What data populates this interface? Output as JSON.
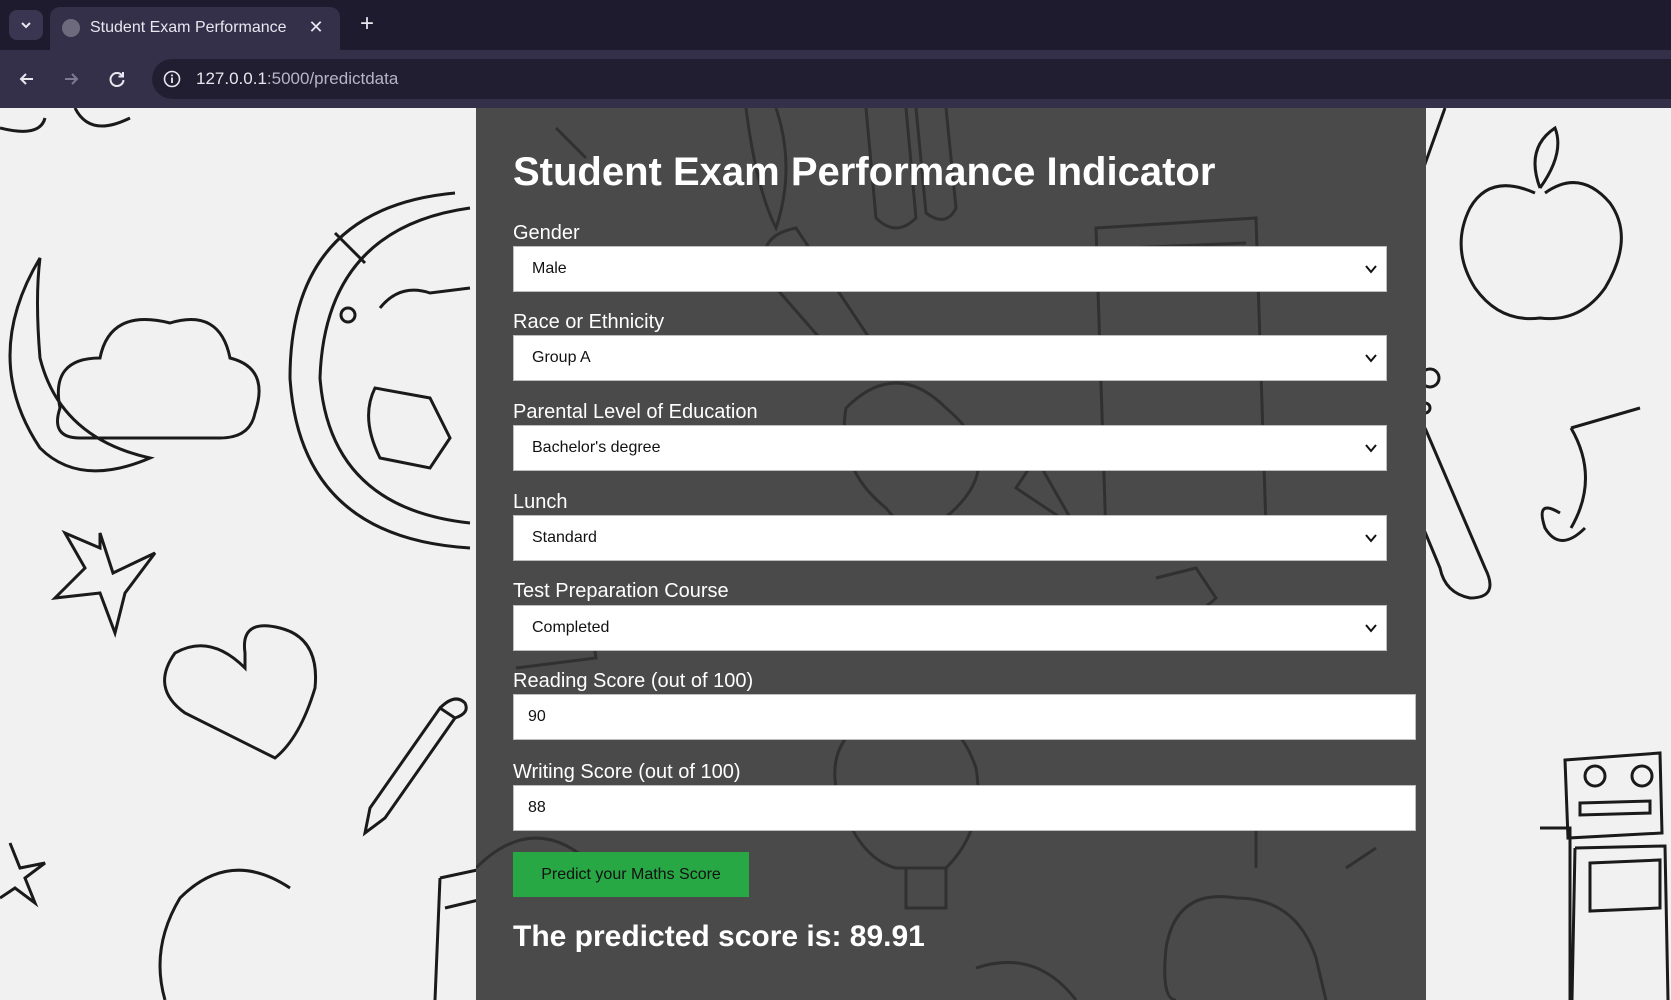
{
  "browser": {
    "tab_title": "Student Exam Performance",
    "url_host": "127.0.0.1",
    "url_rest": ":5000/predictdata"
  },
  "page": {
    "title": "Student Exam Performance Indicator",
    "fields": {
      "gender": {
        "label": "Gender",
        "value": "Male"
      },
      "race": {
        "label": "Race or Ethnicity",
        "value": "Group A"
      },
      "parental_education": {
        "label": "Parental Level of Education",
        "value": "Bachelor's degree"
      },
      "lunch": {
        "label": "Lunch",
        "value": "Standard"
      },
      "test_prep": {
        "label": "Test Preparation Course",
        "value": "Completed"
      },
      "reading_score": {
        "label": "Reading Score (out of 100)",
        "value": "90"
      },
      "writing_score": {
        "label": "Writing Score (out of 100)",
        "value": "88"
      }
    },
    "predict_button": "Predict your Maths Score",
    "result_text": "The predicted score is: 89.91"
  },
  "colors": {
    "panel_bg": "#4a4a4a",
    "button_green": "#28a745",
    "chrome_dark": "#1f1b2e",
    "chrome_toolbar": "#35304a"
  },
  "icons": [
    "tab-list-icon",
    "globe-favicon-icon",
    "close-icon",
    "plus-icon",
    "back-arrow-icon",
    "forward-arrow-icon",
    "reload-icon",
    "info-icon",
    "chevron-down-icon"
  ]
}
